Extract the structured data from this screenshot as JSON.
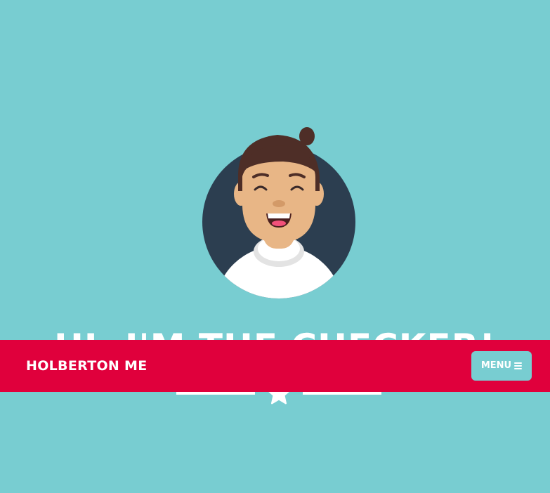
{
  "navbar": {
    "brand": "HOLBERTON ME",
    "menu_label": "MENU",
    "menu_icon": "bars-icon"
  },
  "hero": {
    "title": "HI, I'M THE CHECKER!",
    "avatar": "avatar-illustration",
    "divider_icon": "star-icon"
  },
  "colors": {
    "background": "#78cdd1",
    "navbar": "#e0003c",
    "text": "#ffffff",
    "avatar_circle": "#2c3e50"
  }
}
